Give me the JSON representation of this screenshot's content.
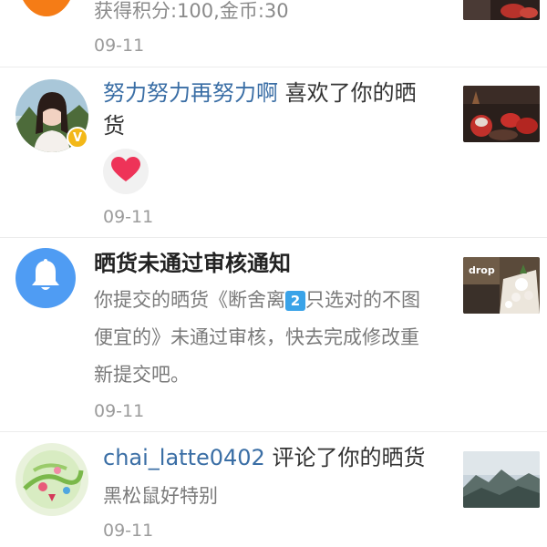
{
  "notifications": [
    {
      "subtitle": "获得积分:100,金币:30",
      "date": "09-11"
    },
    {
      "username": "努力努力再努力啊",
      "action": " 喜欢了你的晒",
      "action_cont": "货",
      "date": "09-11",
      "badge": "V"
    },
    {
      "title": "晒货未通过审核通知",
      "body_line1_pre": "你提交的晒货《断舍离",
      "body_num": "2",
      "body_line1_post": "只选对的不图",
      "body_line2": "便宜的》未通过审核，快去完成修改重",
      "body_line3": "新提交吧。",
      "date": "09-11",
      "thumb_text": "drop"
    },
    {
      "username": "chai_latte0402",
      "action": " 评论了你的晒货",
      "comment": "黑松鼠好特别",
      "date": "09-11"
    }
  ],
  "colors": {
    "username": "#3a6ea5",
    "bell": "#4f9cf3",
    "heart": "#ee3358",
    "orange_avatar": "#f57c16"
  }
}
